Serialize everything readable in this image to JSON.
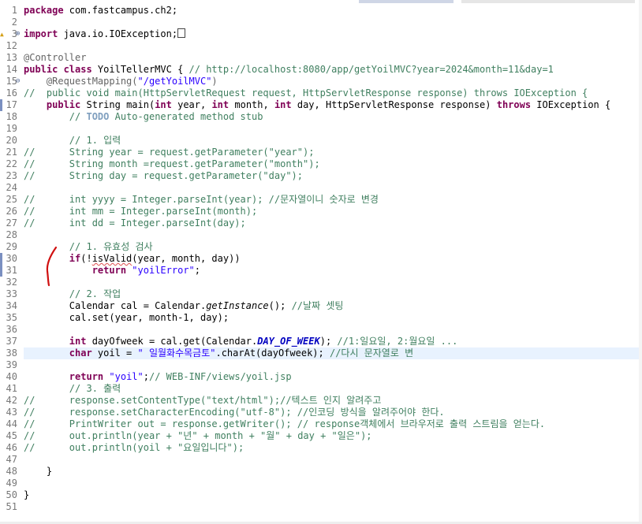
{
  "code_lines": [
    {
      "n": "1",
      "segs": [
        {
          "k": "kw",
          "t": "package"
        },
        {
          "t": " com.fastcampus.ch2;"
        }
      ]
    },
    {
      "n": "2",
      "segs": []
    },
    {
      "n": "3",
      "marker": "warn",
      "fold": "⊕",
      "segs": [
        {
          "k": "kw",
          "t": "import"
        },
        {
          "t": " java.io.IOException;"
        },
        {
          "k": "box",
          "t": ""
        }
      ]
    },
    {
      "n": "12",
      "segs": []
    },
    {
      "n": "13",
      "segs": [
        {
          "k": "an",
          "t": "@Controller"
        }
      ]
    },
    {
      "n": "14",
      "segs": [
        {
          "k": "kw",
          "t": "public class"
        },
        {
          "t": " YoilTellerMVC { "
        },
        {
          "k": "cm",
          "t": "// http://localhost:8080/app/getYoilMVC?year=2024&month=11&day=1"
        }
      ]
    },
    {
      "n": "15",
      "fold": "⊖",
      "segs": [
        {
          "t": "    "
        },
        {
          "k": "an",
          "t": "@RequestMapping("
        },
        {
          "k": "st",
          "t": "\"/getYoilMVC\""
        },
        {
          "k": "an",
          "t": ")"
        }
      ]
    },
    {
      "n": "16",
      "segs": [
        {
          "k": "cm",
          "t": "//  public void main(HttpServletRequest request, HttpServletResponse response) throws IOException {"
        }
      ]
    },
    {
      "n": "17",
      "gm": true,
      "segs": [
        {
          "t": "    "
        },
        {
          "k": "kw",
          "t": "public"
        },
        {
          "t": " String main("
        },
        {
          "k": "kw",
          "t": "int"
        },
        {
          "t": " year, "
        },
        {
          "k": "kw",
          "t": "int"
        },
        {
          "t": " month, "
        },
        {
          "k": "kw",
          "t": "int"
        },
        {
          "t": " day, HttpServletResponse response) "
        },
        {
          "k": "kw",
          "t": "throws"
        },
        {
          "t": " IOException {"
        }
      ]
    },
    {
      "n": "18",
      "segs": [
        {
          "t": "        "
        },
        {
          "k": "cm",
          "t": "// "
        },
        {
          "k": "todo",
          "t": "TODO"
        },
        {
          "k": "cm",
          "t": " Auto-generated method stub"
        }
      ]
    },
    {
      "n": "19",
      "segs": []
    },
    {
      "n": "20",
      "segs": [
        {
          "t": "        "
        },
        {
          "k": "cm",
          "t": "// 1. 입력"
        }
      ]
    },
    {
      "n": "21",
      "segs": [
        {
          "k": "cm",
          "t": "//      String year = request.getParameter(\"year\");"
        }
      ]
    },
    {
      "n": "22",
      "segs": [
        {
          "k": "cm",
          "t": "//      String month =request.getParameter(\"month\");"
        }
      ]
    },
    {
      "n": "23",
      "segs": [
        {
          "k": "cm",
          "t": "//      String day = request.getParameter(\"day\");"
        }
      ]
    },
    {
      "n": "24",
      "segs": []
    },
    {
      "n": "25",
      "segs": [
        {
          "k": "cm",
          "t": "//      int yyyy = Integer.parseInt(year); //문자열이니 숫자로 변경"
        }
      ]
    },
    {
      "n": "26",
      "segs": [
        {
          "k": "cm",
          "t": "//      int mm = Integer.parseInt(month);"
        }
      ]
    },
    {
      "n": "27",
      "segs": [
        {
          "k": "cm",
          "t": "//      int dd = Integer.parseInt(day);"
        }
      ]
    },
    {
      "n": "28",
      "segs": []
    },
    {
      "n": "29",
      "segs": [
        {
          "t": "        "
        },
        {
          "k": "cm",
          "t": "// 1. 유효성 검사"
        }
      ]
    },
    {
      "n": "30",
      "gm": true,
      "segs": [
        {
          "t": "        "
        },
        {
          "k": "kw",
          "t": "if"
        },
        {
          "t": "(!"
        },
        {
          "k": "sq",
          "t": "isValid"
        },
        {
          "t": "(year, month, day))"
        }
      ]
    },
    {
      "n": "31",
      "gm": true,
      "segs": [
        {
          "t": "            "
        },
        {
          "k": "kw",
          "t": "return"
        },
        {
          "t": " "
        },
        {
          "k": "st",
          "t": "\"yoilError\""
        },
        {
          "t": ";"
        }
      ]
    },
    {
      "n": "32",
      "segs": []
    },
    {
      "n": "33",
      "segs": [
        {
          "t": "        "
        },
        {
          "k": "cm",
          "t": "// 2. 작업"
        }
      ]
    },
    {
      "n": "34",
      "segs": [
        {
          "t": "        Calendar cal = Calendar."
        },
        {
          "k": "it",
          "t": "getInstance"
        },
        {
          "t": "(); "
        },
        {
          "k": "cm",
          "t": "//날짜 셋팅"
        }
      ]
    },
    {
      "n": "35",
      "segs": [
        {
          "t": "        cal.set(year, month-1, day);"
        }
      ]
    },
    {
      "n": "36",
      "segs": []
    },
    {
      "n": "37",
      "segs": [
        {
          "t": "        "
        },
        {
          "k": "kw",
          "t": "int"
        },
        {
          "t": " dayOfweek = cal.get(Calendar."
        },
        {
          "k": "sf",
          "t": "DAY_OF_WEEK"
        },
        {
          "t": "); "
        },
        {
          "k": "cm",
          "t": "//1:일요일, 2:월요일 ..."
        }
      ]
    },
    {
      "n": "38",
      "cur": true,
      "segs": [
        {
          "t": "        "
        },
        {
          "k": "kw",
          "t": "char"
        },
        {
          "t": " yoil = "
        },
        {
          "k": "st",
          "t": "\" 일월화수목금토\""
        },
        {
          "t": ".charAt(dayOfweek); "
        },
        {
          "k": "cm",
          "t": "//다시 문자열로 변"
        }
      ]
    },
    {
      "n": "39",
      "segs": []
    },
    {
      "n": "40",
      "segs": [
        {
          "t": "        "
        },
        {
          "k": "kw",
          "t": "return"
        },
        {
          "t": " "
        },
        {
          "k": "st",
          "t": "\"yoil\""
        },
        {
          "t": ";"
        },
        {
          "k": "cm",
          "t": "// WEB-INF/views/yoil.jsp"
        }
      ]
    },
    {
      "n": "41",
      "segs": [
        {
          "t": "        "
        },
        {
          "k": "cm",
          "t": "// 3. 출력"
        }
      ]
    },
    {
      "n": "42",
      "segs": [
        {
          "k": "cm",
          "t": "//      response.setContentType(\"text/html\");//텍스트 인지 알려주고"
        }
      ]
    },
    {
      "n": "43",
      "segs": [
        {
          "k": "cm",
          "t": "//      response.setCharacterEncoding(\"utf-8\"); //인코딩 방식을 알려주어야 한다."
        }
      ]
    },
    {
      "n": "44",
      "segs": [
        {
          "k": "cm",
          "t": "//      PrintWriter out = response.getWriter(); // response객체에서 브라우저로 출력 스트림을 얻는다."
        }
      ]
    },
    {
      "n": "45",
      "segs": [
        {
          "k": "cm",
          "t": "//      out.println(year + \"년\" + month + \"월\" + day + \"일은\");"
        }
      ]
    },
    {
      "n": "46",
      "segs": [
        {
          "k": "cm",
          "t": "//      out.println(yoil + \"요일입니다\");"
        }
      ]
    },
    {
      "n": "47",
      "segs": []
    },
    {
      "n": "48",
      "segs": [
        {
          "t": "    }"
        }
      ]
    },
    {
      "n": "49",
      "segs": []
    },
    {
      "n": "50",
      "segs": [
        {
          "t": "}"
        }
      ]
    },
    {
      "n": "51",
      "segs": []
    }
  ],
  "colors": {
    "keyword": "#7f0055",
    "comment": "#3f7f5f",
    "string": "#2a00ff",
    "annotation": "#646464",
    "static_field": "#0000c0",
    "current_line": "#e8f2fe",
    "pen_mark": "#d01010"
  }
}
